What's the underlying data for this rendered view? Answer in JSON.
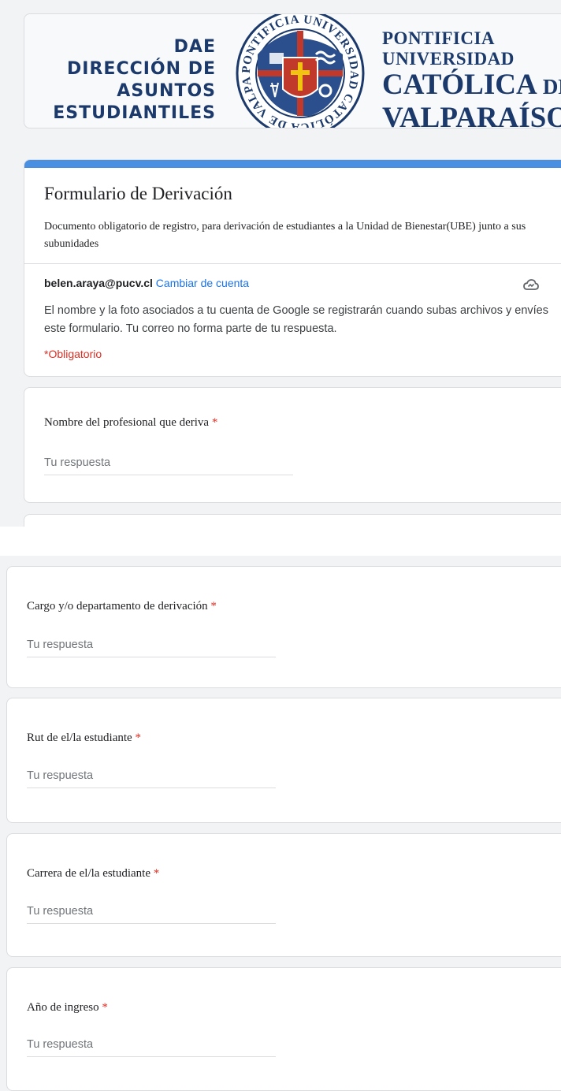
{
  "banner": {
    "dae_lines": [
      "DAE",
      "DIRECCIÓN DE",
      "ASUNTOS",
      "ESTUDIANTILES"
    ],
    "university_lines": [
      "PONTIFICIA",
      "UNIVERSIDAD",
      "CATÓLICA",
      "DE",
      "VALPARAÍSO"
    ],
    "seal_text": "PONTIFICIA UNIVERSIDAD CATÓLICA DE VALPARAÍSO",
    "colors": {
      "navy": "#1b3a6b",
      "seal_red": "#c0392b"
    }
  },
  "form": {
    "title": "Formulario de Derivación",
    "description": "Documento obligatorio de registro, para derivación de estudiantes a la Unidad de Bienestar(UBE) junto a sus subunidades",
    "account_email": "belen.araya@pucv.cl",
    "switch_account": "Cambiar de cuenta",
    "cloud_icon": "cloud-icon",
    "notice": "El nombre y la foto asociados a tu cuenta de Google se registrarán cuando subas archivos y envíes este formulario. Tu correo no forma parte de tu respuesta.",
    "required_note": "*Obligatorio",
    "accent_color": "#4a90e2",
    "required_color": "#d93025"
  },
  "questions": [
    {
      "label": "Nombre del profesional que deriva",
      "star": "*",
      "placeholder": "Tu respuesta"
    },
    {
      "label": "Cargo y/o departamento de derivación",
      "star": "*",
      "placeholder": "Tu respuesta"
    },
    {
      "label": "Rut de el/la estudiante",
      "star": "*",
      "placeholder": "Tu respuesta"
    },
    {
      "label": "Carrera de el/la estudiante",
      "star": "*",
      "placeholder": "Tu respuesta"
    },
    {
      "label": "Año de ingreso",
      "star": "*",
      "placeholder": "Tu respuesta"
    }
  ]
}
